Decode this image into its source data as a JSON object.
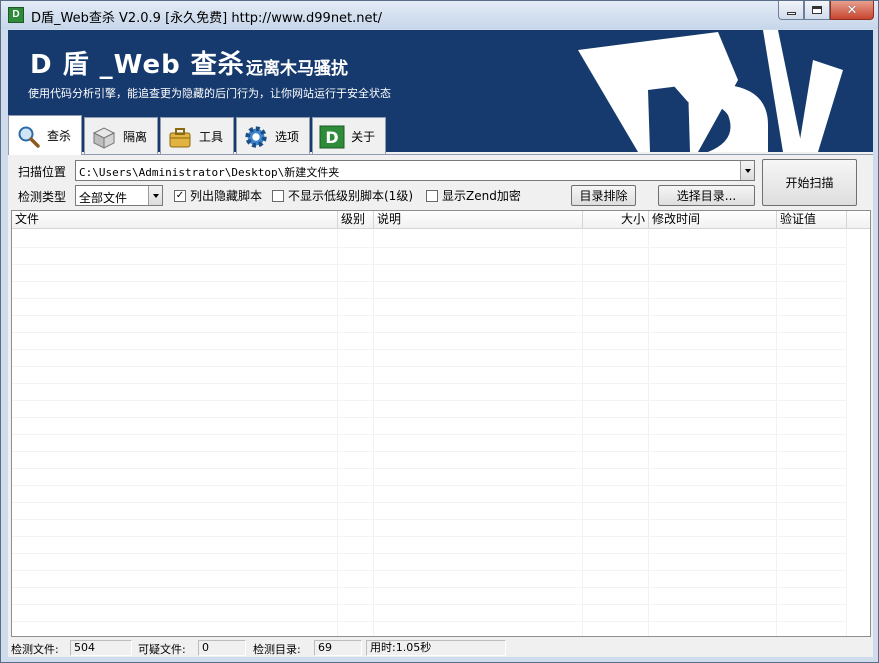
{
  "window": {
    "title": "D盾_Web查杀 V2.0.9 [永久免费] http://www.d99net.net/",
    "icon": "app-shield-icon"
  },
  "banner": {
    "title": "D 盾 _Web 查杀",
    "tagline": "远离木马骚扰",
    "subtitle": "使用代码分析引擎，能追查更为隐藏的后门行为，让你网站运行于安全状态"
  },
  "tabs": [
    {
      "label": "查杀",
      "icon": "magnifier-icon",
      "active": true
    },
    {
      "label": "隔离",
      "icon": "isolation-box-icon",
      "active": false
    },
    {
      "label": "工具",
      "icon": "toolbox-icon",
      "active": false
    },
    {
      "label": "选项",
      "icon": "gear-icon",
      "active": false
    },
    {
      "label": "关于",
      "icon": "d-logo-icon",
      "active": false
    }
  ],
  "scan": {
    "location_label": "扫描位置",
    "location_value": "C:\\Users\\Administrator\\Desktop\\新建文件夹",
    "type_label": "检测类型",
    "type_value": "全部文件",
    "opt_hidden": {
      "label": "列出隐藏脚本",
      "checked": true
    },
    "opt_lowlevel": {
      "label": "不显示低级别脚本(1级)",
      "checked": false
    },
    "opt_zend": {
      "label": "显示Zend加密",
      "checked": false
    },
    "exclude_button": "目录排除",
    "select_dir_button": "选择目录...",
    "start_button": "开始扫描"
  },
  "list": {
    "columns": [
      "文件",
      "级别",
      "说明",
      "大小",
      "修改时间",
      "验证值"
    ],
    "rows": []
  },
  "status": {
    "files_label": "检测文件:",
    "files_value": "504",
    "suspicious_label": "可疑文件:",
    "suspicious_value": "0",
    "dirs_label": "检测目录:",
    "dirs_value": "69",
    "time_value": "用时:1.05秒"
  },
  "colors": {
    "banner_bg": "#173a6e",
    "frame": "#cfdcec"
  }
}
